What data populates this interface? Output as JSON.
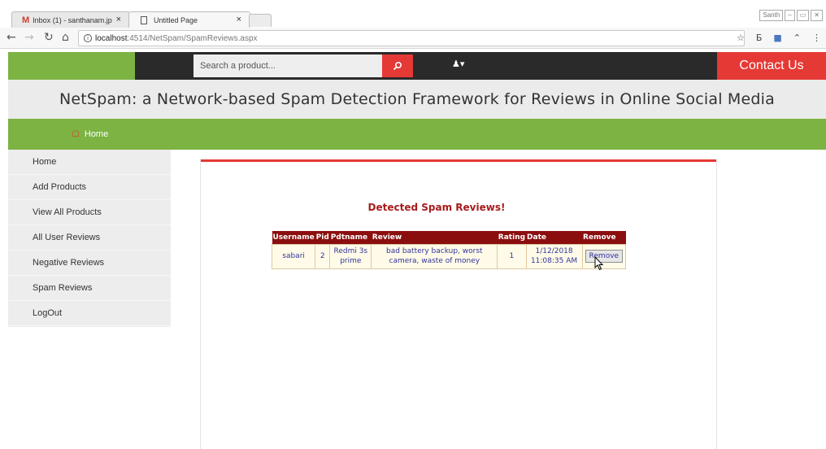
{
  "browser": {
    "tabs": [
      {
        "label": "Inbox (1) - santhanam.jp",
        "icon": "gmail-icon"
      },
      {
        "label": "Untitled Page",
        "icon": "page-icon"
      }
    ],
    "tab_close": "×",
    "url_host": "localhost",
    "url_path": ":4514/NetSpam/SpamReviews.aspx",
    "window_controls": [
      "Santh",
      "–",
      "▭",
      "✕"
    ]
  },
  "header": {
    "search_placeholder": "Search a product...",
    "contact_label": "Contact Us",
    "title": "NetSpam: a Network-based Spam Detection Framework for Reviews in Online Social Media",
    "nav_home": "Home"
  },
  "sidebar": {
    "items": [
      {
        "label": "Home"
      },
      {
        "label": "Add Products"
      },
      {
        "label": "View All Products"
      },
      {
        "label": "All User Reviews"
      },
      {
        "label": "Negative Reviews"
      },
      {
        "label": "Spam Reviews"
      },
      {
        "label": "LogOut"
      }
    ]
  },
  "main": {
    "section_title": "Detected Spam Reviews!",
    "table": {
      "headers": [
        "Username",
        "Pid",
        "Pdtname",
        "Review",
        "Rating",
        "Date",
        "Remove"
      ],
      "rows": [
        {
          "username": "sabari",
          "pid": "2",
          "pdtname": "Redmi 3s prime",
          "review": "bad battery backup, worst camera, waste of money",
          "rating": "1",
          "date": "1/12/2018 11:08:35 AM",
          "remove_label": "Remove"
        }
      ]
    }
  },
  "colors": {
    "accent_green": "#7cb342",
    "accent_red": "#e53935",
    "table_header": "#8b0e0e",
    "title_red": "#a61c1c"
  }
}
